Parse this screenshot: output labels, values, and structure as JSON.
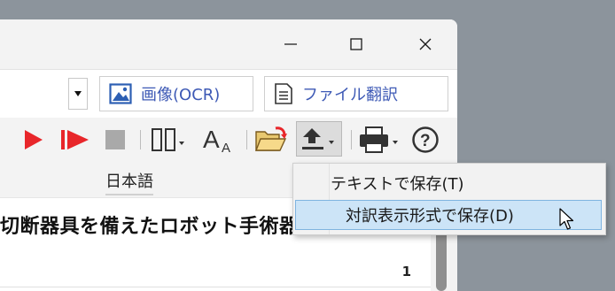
{
  "window": {
    "controls": {
      "minimize": "—",
      "maximize": "☐",
      "close": "✕"
    }
  },
  "toolbar": {
    "image_ocr_label": "画像(OCR)",
    "file_translate_label": "ファイル翻訳"
  },
  "language": {
    "tab_label": "日本語"
  },
  "content": {
    "text": "切断器具を備えたロボット手術器具",
    "page_number": "1"
  },
  "save_menu": {
    "items": [
      {
        "label": "テキストで保存(T)"
      },
      {
        "label": "対訳表示形式で保存(D)"
      }
    ]
  },
  "colors": {
    "accent_blue": "#3d59b5",
    "play_red": "#e8262a",
    "menu_highlight": "#cce4f7",
    "menu_highlight_border": "#7fb4e0"
  }
}
